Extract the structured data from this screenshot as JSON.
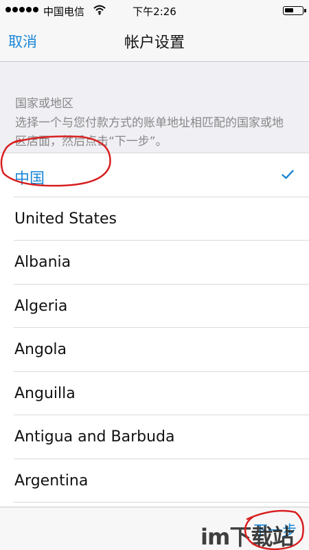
{
  "status_bar": {
    "carrier": "中国电信",
    "time": "下午2:26"
  },
  "nav": {
    "cancel_label": "取消",
    "title": "帐户设置"
  },
  "section": {
    "title": "国家或地区",
    "description": "选择一个与您付款方式的账单地址相匹配的国家或地区店面，然后点击“下一步”。"
  },
  "countries": [
    {
      "name": "中国",
      "selected": true
    },
    {
      "name": "United States",
      "selected": false
    },
    {
      "name": "Albania",
      "selected": false
    },
    {
      "name": "Algeria",
      "selected": false
    },
    {
      "name": "Angola",
      "selected": false
    },
    {
      "name": "Anguilla",
      "selected": false
    },
    {
      "name": "Antigua and Barbuda",
      "selected": false
    },
    {
      "name": "Argentina",
      "selected": false
    }
  ],
  "toolbar": {
    "next_label": "下一步"
  },
  "watermark": {
    "text": "im下载站"
  },
  "colors": {
    "accent": "#1a86d6",
    "annotation": "#d81e1e"
  },
  "icons": {
    "check": "checkmark-icon",
    "wifi": "wifi-icon",
    "battery": "battery-icon"
  }
}
